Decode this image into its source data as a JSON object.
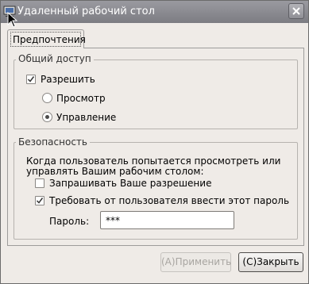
{
  "window": {
    "title": "Удаленный рабочий стол",
    "icon": "remote-desktop-icon",
    "close_icon": "close-icon"
  },
  "tabs": [
    {
      "label": "Предпочтения",
      "selected": true
    }
  ],
  "sharing": {
    "label": "Общий доступ",
    "allow": {
      "label": "Разрешить",
      "checked": true
    },
    "view_only": {
      "label": "Просмотр",
      "selected": false
    },
    "control": {
      "label": "Управление",
      "selected": true
    }
  },
  "security": {
    "label": "Безопасность",
    "description_line1": "Когда пользователь попытается просмотреть или",
    "description_line2": "управлять Вашим рабочим столом:",
    "ask_permission": {
      "label": "Запрашивать Ваше разрешение",
      "checked": false
    },
    "require_password": {
      "label": "Требовать от пользователя ввести этот пароль",
      "checked": true
    },
    "password_label": "Пароль:",
    "password_value": "***"
  },
  "buttons": {
    "apply": {
      "label": "(A)Применить",
      "enabled": false
    },
    "close": {
      "label": "(C)Закрыть",
      "enabled": true
    }
  },
  "colors": {
    "titlebar": "#8a8a90",
    "window_bg": "#efebe7",
    "disabled_text": "#a8a5a1"
  }
}
